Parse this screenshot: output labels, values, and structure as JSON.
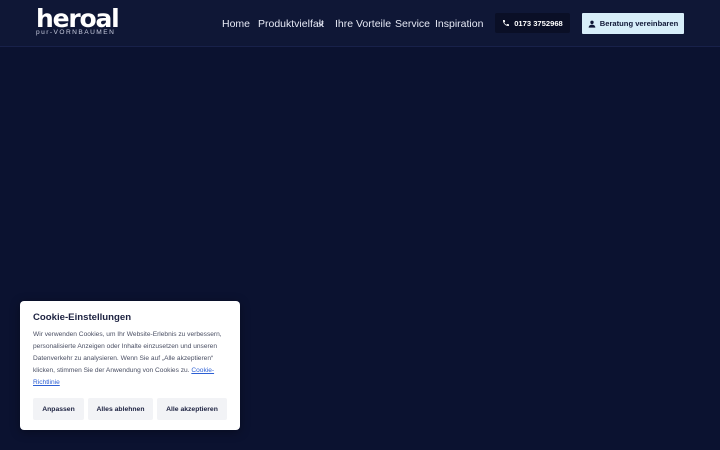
{
  "brand": {
    "logo_text": "heroal",
    "tagline": "pur-VORNBAUMEN"
  },
  "nav": {
    "items": [
      {
        "label": "Home"
      },
      {
        "label": "Produktvielfalt",
        "icon": "chevron-down-icon"
      },
      {
        "label": "Ihre Vorteile"
      },
      {
        "label": "Service"
      },
      {
        "label": "Inspiration"
      }
    ]
  },
  "header_actions": {
    "phone_label": "0173 3752968",
    "phone_icon": "phone-icon",
    "consult_label": "Beratung vereinbaren",
    "consult_icon": "user-icon"
  },
  "cookie_banner": {
    "title": "Cookie-Einstellungen",
    "text": "Wir verwenden Cookies, um Ihr Website-Erlebnis zu verbessern, personalisierte Anzeigen oder Inhalte einzusetzen und unseren Datenverkehr zu analysieren. Wenn Sie auf „Alle akzeptieren“ klicken, stimmen Sie der Anwendung von Cookies zu.",
    "link_text": "Cookie-Richtlinie",
    "buttons": {
      "customize": "Anpassen",
      "reject_all": "Alles ablehnen",
      "accept_all": "Alle akzeptieren"
    }
  },
  "colors": {
    "page_background": "#0b1230",
    "header_background": "#0f1736",
    "consult_button": "#d7eef9",
    "link": "#2c5fd4"
  }
}
